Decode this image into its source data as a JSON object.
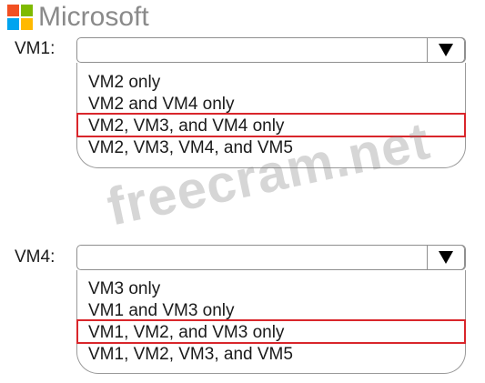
{
  "brand": {
    "name": "Microsoft",
    "logo_colors": [
      "#f25022",
      "#7fba00",
      "#00a4ef",
      "#ffb900"
    ]
  },
  "watermark": "freecram.net",
  "dropdowns": [
    {
      "label": "VM1:",
      "selected_value": "",
      "arrow_icon": "triangle-down-icon",
      "options": [
        "VM2 only",
        "VM2 and VM4 only",
        "VM2, VM3, and VM4 only",
        "VM2, VM3, VM4, and VM5"
      ],
      "highlighted_option": "VM2, VM3, and VM4 only"
    },
    {
      "label": "VM4:",
      "selected_value": "",
      "arrow_icon": "triangle-down-icon",
      "options": [
        "VM3 only",
        "VM1 and VM3 only",
        "VM1, VM2, and VM3 only",
        "VM1, VM2, VM3, and VM5"
      ],
      "highlighted_option": "VM1, VM2, and VM3 only"
    }
  ],
  "colors": {
    "highlight": "#d9262b",
    "border": "#8f8f8f"
  }
}
